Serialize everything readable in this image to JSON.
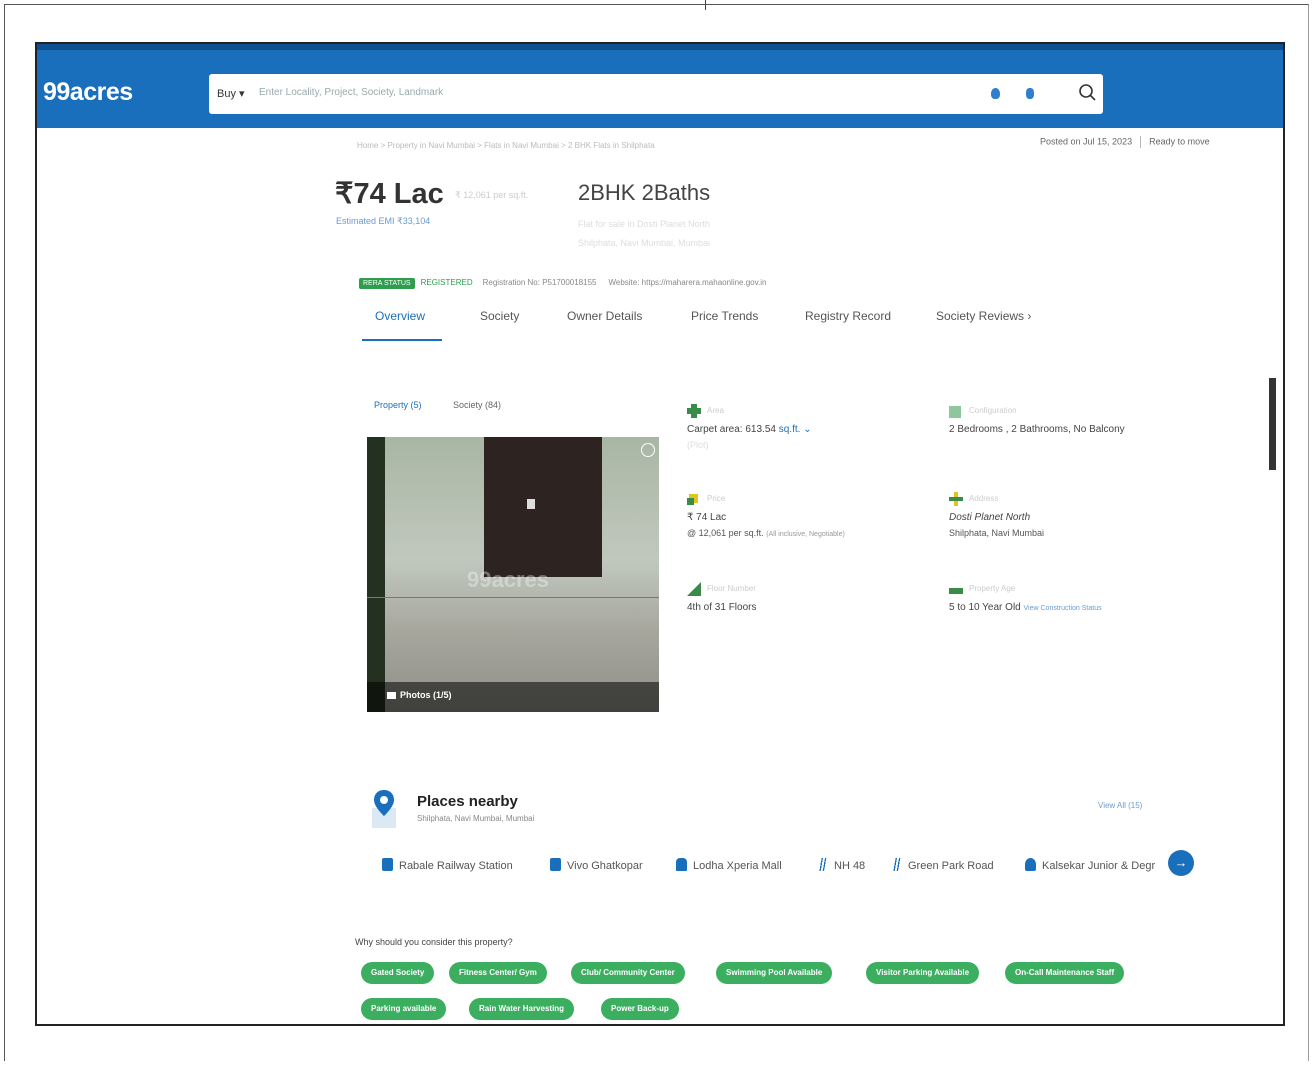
{
  "header": {
    "logo": "99acres",
    "buy_label": "Buy ▾",
    "search_placeholder": "Enter Locality, Project, Society, Landmark"
  },
  "listing": {
    "breadcrumb": "Home > Property in Navi Mumbai > Flats in Navi Mumbai > 2 BHK Flats in Shilphata",
    "posted": "Posted on Jul 15, 2023",
    "ready": "Ready to move",
    "price": "₹74 Lac",
    "price_sub": "₹ 12,061 per sq.ft.",
    "emi": "Estimated EMI ₹33,104",
    "title": "2BHK 2Baths",
    "subtitle1": "Flat for sale in Dosti Planet North",
    "subtitle2": "Shilphata, Navi Mumbai, Mumbai",
    "rera_badge": "RERA STATUS",
    "rera_registered": "REGISTERED",
    "rera_number": "Registration No: P51700018155",
    "rera_website": "Website: https://maharera.mahaonline.gov.in"
  },
  "tabs": [
    "Overview",
    "Society",
    "Owner Details",
    "Price Trends",
    "Registry Record",
    "Society Reviews  ›"
  ],
  "media_filter": {
    "property": "Property (5)",
    "society": "Society (84)"
  },
  "photo": {
    "watermark": "99acres",
    "photos_label": "Photos (1/5)"
  },
  "details": {
    "area": {
      "label": "Area",
      "value": "Carpet area: 613.54",
      "unit": "sq.ft. ⌄",
      "sub": "(Plot)"
    },
    "config": {
      "label": "Configuration",
      "value": "2 Bedrooms , 2 Bathrooms, No Balcony"
    },
    "price": {
      "label": "Price",
      "value": "₹ 74 Lac",
      "sub": "@ 12,061 per sq.ft.",
      "sub_note": "(All inclusive, Negotiable)"
    },
    "address": {
      "label": "Address",
      "value": "Dosti Planet North",
      "sub": "Shilphata, Navi Mumbai"
    },
    "floor": {
      "label": "Floor Number",
      "value": "4th of 31 Floors"
    },
    "age": {
      "label": "Property Age",
      "value": "5 to 10 Year Old",
      "link": "View Construction Status"
    }
  },
  "places": {
    "title": "Places nearby",
    "subtitle": "Shilphata, Navi Mumbai, Mumbai",
    "view_all": "View All (15)",
    "items": [
      {
        "name": "Rabale Railway Station",
        "icon": "train-icon",
        "color": "#1a6fbd"
      },
      {
        "name": "Vivo Ghatkopar",
        "icon": "bus-icon",
        "color": "#1a6fbd"
      },
      {
        "name": "Lodha Xperia Mall",
        "icon": "shopping-bag-icon",
        "color": "#1a6fbd"
      },
      {
        "name": "NH 48",
        "icon": "road-icon",
        "color": "#1a6fbd"
      },
      {
        "name": "Green Park Road",
        "icon": "road-icon",
        "color": "#1a6fbd"
      },
      {
        "name": "Kalsekar Junior & Degr",
        "icon": "graduation-cap-icon",
        "color": "#1a6fbd"
      }
    ]
  },
  "why": {
    "title": "Why should you consider this property?",
    "chips": [
      "Gated Society",
      "Fitness Center/ Gym",
      "Club/ Community Center",
      "Swimming Pool Available",
      "Visitor Parking Available",
      "On-Call Maintenance Staff",
      "Parking available",
      "Rain Water Harvesting",
      "Power Back-up"
    ]
  },
  "colors": {
    "brand": "#1a6fbd",
    "green": "#3cae5f"
  }
}
